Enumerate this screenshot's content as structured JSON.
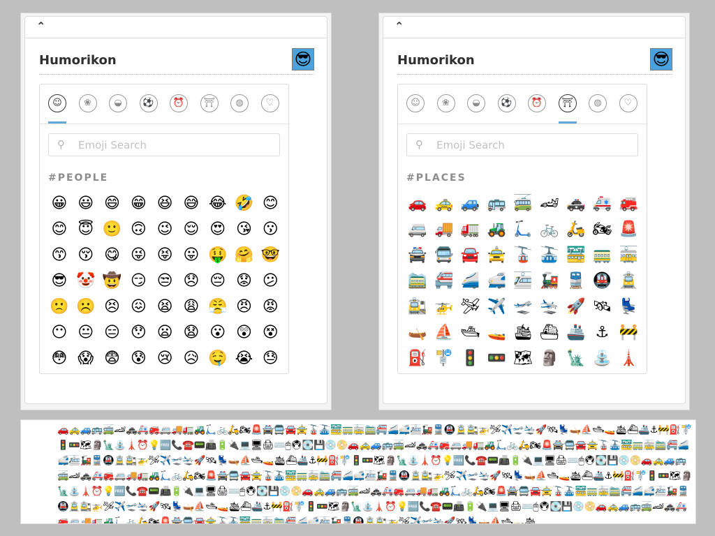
{
  "left_panel": {
    "collapse_glyph": "⌃",
    "title": "Humorikon",
    "avatar_emoji": "😎",
    "search_placeholder": "Emoji Search",
    "category_label": "#PEOPLE",
    "tabs": [
      {
        "name": "people",
        "glyph": "☺",
        "active": true
      },
      {
        "name": "nature",
        "glyph": "❀",
        "active": false
      },
      {
        "name": "food",
        "glyph": "◒",
        "active": false
      },
      {
        "name": "activity",
        "glyph": "⚽",
        "active": false
      },
      {
        "name": "travel",
        "glyph": "⏰",
        "active": false
      },
      {
        "name": "places",
        "glyph": "⛩",
        "active": false
      },
      {
        "name": "objects",
        "glyph": "◍",
        "active": false
      },
      {
        "name": "symbols",
        "glyph": "♡",
        "active": false
      }
    ],
    "emojis": [
      "😀",
      "😃",
      "😄",
      "😁",
      "😆",
      "😅",
      "😂",
      "🤣",
      "😊",
      "😊",
      "😇",
      "🙂",
      "🙃",
      "😉",
      "😌",
      "😍",
      "😘",
      "😗",
      "😙",
      "😚",
      "😋",
      "😜",
      "😝",
      "😛",
      "🤑",
      "🤗",
      "🤓",
      "😎",
      "🤡",
      "🤠",
      "😏",
      "😒",
      "😞",
      "😔",
      "😟",
      "😕",
      "🙁",
      "☹️",
      "😣",
      "😖",
      "😫",
      "😩",
      "😤",
      "😠",
      "😡",
      "😶",
      "😐",
      "😑",
      "😯",
      "😦",
      "😧",
      "😮",
      "😲",
      "😵",
      "😳",
      "😱",
      "😨",
      "😰",
      "😢",
      "😥",
      "🤤",
      "😭",
      "😓"
    ]
  },
  "right_panel": {
    "collapse_glyph": "⌃",
    "title": "Humorikon",
    "avatar_emoji": "😎",
    "search_placeholder": "Emoji Search",
    "category_label": "#PLACES",
    "tabs": [
      {
        "name": "people",
        "glyph": "☺",
        "active": false
      },
      {
        "name": "nature",
        "glyph": "❀",
        "active": false
      },
      {
        "name": "food",
        "glyph": "◒",
        "active": false
      },
      {
        "name": "activity",
        "glyph": "⚽",
        "active": false
      },
      {
        "name": "travel",
        "glyph": "⏰",
        "active": false
      },
      {
        "name": "places",
        "glyph": "⛩",
        "active": true
      },
      {
        "name": "objects",
        "glyph": "◍",
        "active": false
      },
      {
        "name": "symbols",
        "glyph": "♡",
        "active": false
      }
    ],
    "emojis": [
      "🚗",
      "🚕",
      "🚙",
      "🚌",
      "🚎",
      "🏎",
      "🚓",
      "🚑",
      "🚒",
      "🚐",
      "🚚",
      "🚛",
      "🚜",
      "🛴",
      "🚲",
      "🛵",
      "🏍",
      "🚨",
      "🚔",
      "🚍",
      "🚘",
      "🚖",
      "🚡",
      "🚠",
      "🚟",
      "🚃",
      "🚋",
      "🚞",
      "🚝",
      "🚄",
      "🚅",
      "🚈",
      "🚂",
      "🚆",
      "🚇",
      "🚊",
      "🚉",
      "🚁",
      "🛩",
      "✈️",
      "🛫",
      "🛬",
      "🚀",
      "🛰",
      "💺",
      "🛶",
      "⛵",
      "🛥",
      "🚤",
      "🛳",
      "⛴",
      "🚢",
      "⚓",
      "🚧",
      "⛽",
      "🚏",
      "🚦",
      "🚥",
      "🗺",
      "🗿",
      "🗽",
      "⛲",
      "🗼"
    ]
  },
  "strip": {
    "text": "🚗🚕🚙🚌🚎🏎🚓🚑🚒🚐🚚🚛🚜🛴🚲🛵🏍🚨🚔🚍🚘🚖🚡🚠🚟🚃🚋🚞🚝🚄🚅🚈🚂🚆🚇🚊🚉🚁🛩✈️🛫🛬🚀🛰💺🛶⛵🛥🚤🛳⛴🚢⚓🚧⛽🚏🚦🚥🗺🗿🗽⛲🗼⏰💡🆓📞☎️📟📠🔋🔌💻🖥🖨⌨️🖱🖲💽💾💿📀🚗🚕🚙🚌🚎🏎🚓🚑🚒🚐🚚🚛🚜🛴🚲🛵🏍🚨🚔🚍🚘🚖🚡🚠🚟🚃🚋🚞🚝🚄🚅🚈🚂🚆🚇🚊🚉🚁🛩✈️🛫🛬🚀🛰💺🛶⛵🛥🚤🛳⛴🚢⚓🚧⛽🚏🚦🚥🗺🗿🗽⛲🗼⏰💡🆓📞☎️📟📠🔋🔌💻🖥🖨⌨️🖱🖲💽💾💿📀🚗🚕🚙🚌🚎🏎🚓🚑🚒🚐🚚🚛🚜🛴🚲🛵🏍🚨🚔🚍🚘🚖🚡🚠🚟🚃🚋🚞🚝🚄🚅🚈🚂🚆🚇🚊🚉🚁🛩✈️🛫🛬🚀🛰💺🛶⛵🛥🚤🛳⛴🚢⚓🚧⛽🚏🚦🚥🗺🗿🗽⛲🗼⏰💡🆓📞☎️📟📠🔋🔌💻🖥🖨⌨️🖱🖲💽💾💿📀🚗🚕🚙🚌🚎🏎🚓🚑🚒🚐🚚🚛🚜🛴🚲🛵🏍🚨🚔🚍🚘🚖🚡🚠🚟🚃🚋🚞🚝🚄🚅🚈🚂🚆🚇🚊🚉🚁🛩✈️🛫🛬🚀🛰💺🛶⛵🛥🚤🛳⛴🚢⚓🚧⛽🚏🚦🚥🗺🗿🗽⛲🗼⏰💡🆓📞☎️📟📠🔋🔌💻🖥🖨⌨️🖱🖲💽💾💿📀🚗🚕🚙🚌🚎🏎🚓🚑🚒🚐🚚🚛🚜🛴🚲🛵🏍🚨🚔🚍🚘🚖🚡🚠🚟🚃🚋🚞🚝🚄🚅🚈🚂🚆🚇🚊🚉🚁🛩✈️🛫🛬🚀🛰💺🛶⛵🛥🚤🛳"
  },
  "colors": {
    "accent_underline": "#62a8d8",
    "avatar_bg": "#4aa3df",
    "page_bg": "#bfbfbf"
  }
}
